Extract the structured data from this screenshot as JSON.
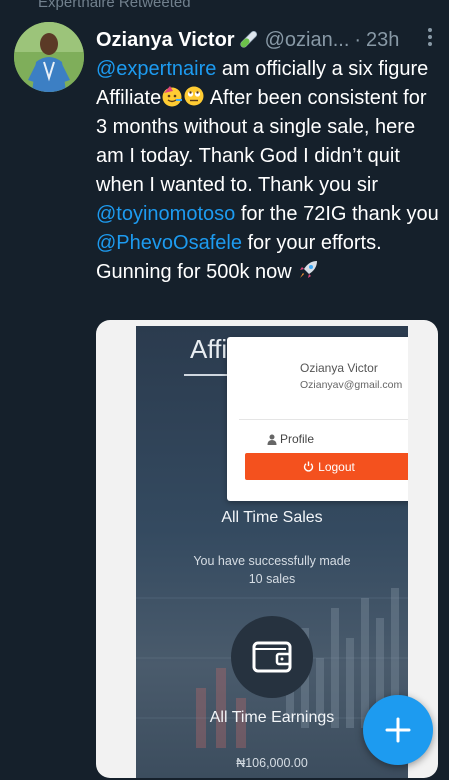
{
  "retweet": {
    "text": "Expertnaire Retweeted"
  },
  "tweet": {
    "author_name": "Ozianya Victor",
    "author_handle": "@ozian",
    "handle_ellipsis": "...",
    "dot": "·",
    "time": "23h",
    "text": {
      "mention1": "@expertnaire",
      "p1": " am officially a six figure Affiliate",
      "p2": " After been consistent for 3 months without a single sale, here am I today. Thank God I didn’t quit when I wanted to. Thank you sir ",
      "mention2": "@toyinomotoso",
      "p3": " for the 72IG thank you ",
      "mention3": "@PhevoOsafele",
      "p4": " for your efforts.",
      "p5": "Gunning for 500k now "
    }
  },
  "media": {
    "app_title": "Affi",
    "dropdown": {
      "name": "Ozianya Victor",
      "email": "Ozianyav@gmail.com",
      "profile_label": "Profile",
      "logout_label": "Logout"
    },
    "sales_label": "All Time Sales",
    "sales_sub_line1": "You have successfully made",
    "sales_sub_line2": "10 sales",
    "earnings_label": "All Time Earnings",
    "earnings_value": "₦106,000.00"
  },
  "icons": {
    "more": "more-vertical-icon",
    "fab": "compose-plus-icon",
    "wallet": "wallet-icon",
    "rocket": "rocket-icon"
  },
  "colors": {
    "background": "#15202b",
    "mention": "#1d9bf0",
    "secondary_text": "#8899a6",
    "logout": "#f4511e",
    "fab": "#1d9bf0"
  }
}
